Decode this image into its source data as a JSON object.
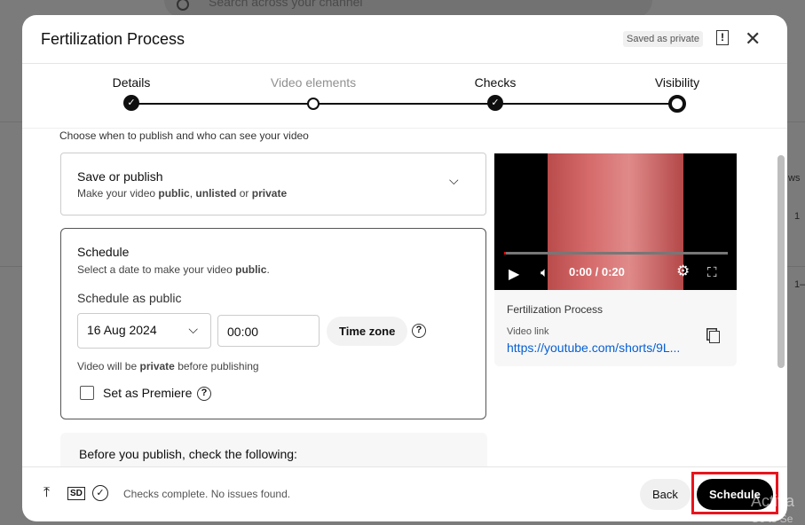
{
  "background": {
    "search_placeholder": "Search across your channel",
    "col_fragment": "ws",
    "row1": "1",
    "row2": "1–",
    "watermark1": "Activa",
    "watermark2": "Go to Se"
  },
  "header": {
    "title": "Fertilization Process",
    "saved_badge": "Saved as private",
    "feedback_icon": "!",
    "close_icon": "✕"
  },
  "steps": [
    {
      "label": "Details",
      "state": "done"
    },
    {
      "label": "Video elements",
      "state": "pending"
    },
    {
      "label": "Checks",
      "state": "done"
    },
    {
      "label": "Visibility",
      "state": "current"
    }
  ],
  "intro": "Choose when to publish and who can see your video",
  "save_publish": {
    "title": "Save or publish",
    "sub_pre": "Make your video ",
    "b1": "public",
    "c1": ", ",
    "b2": "unlisted",
    "c2": " or ",
    "b3": "private"
  },
  "schedule": {
    "title": "Schedule",
    "sub_pre": "Select a date to make your video ",
    "sub_b": "public",
    "sub_post": ".",
    "label": "Schedule as public",
    "date": "16 Aug 2024",
    "time": "00:00",
    "timezone": "Time zone",
    "note_pre": "Video will be ",
    "note_b": "private",
    "note_post": " before publishing",
    "premiere": "Set as Premiere",
    "premiere_checked": false
  },
  "before": "Before you publish, check the following:",
  "video": {
    "time": "0:00 / 0:20",
    "progress": 0,
    "title": "Fertilization Process",
    "link_label": "Video link",
    "link": "https://youtube.com/shorts/9L..."
  },
  "footer": {
    "status": "Checks complete. No issues found.",
    "sd": "SD",
    "back": "Back",
    "schedule": "Schedule"
  },
  "colors": {
    "highlight": "#e8141d",
    "link": "#065fd4"
  }
}
